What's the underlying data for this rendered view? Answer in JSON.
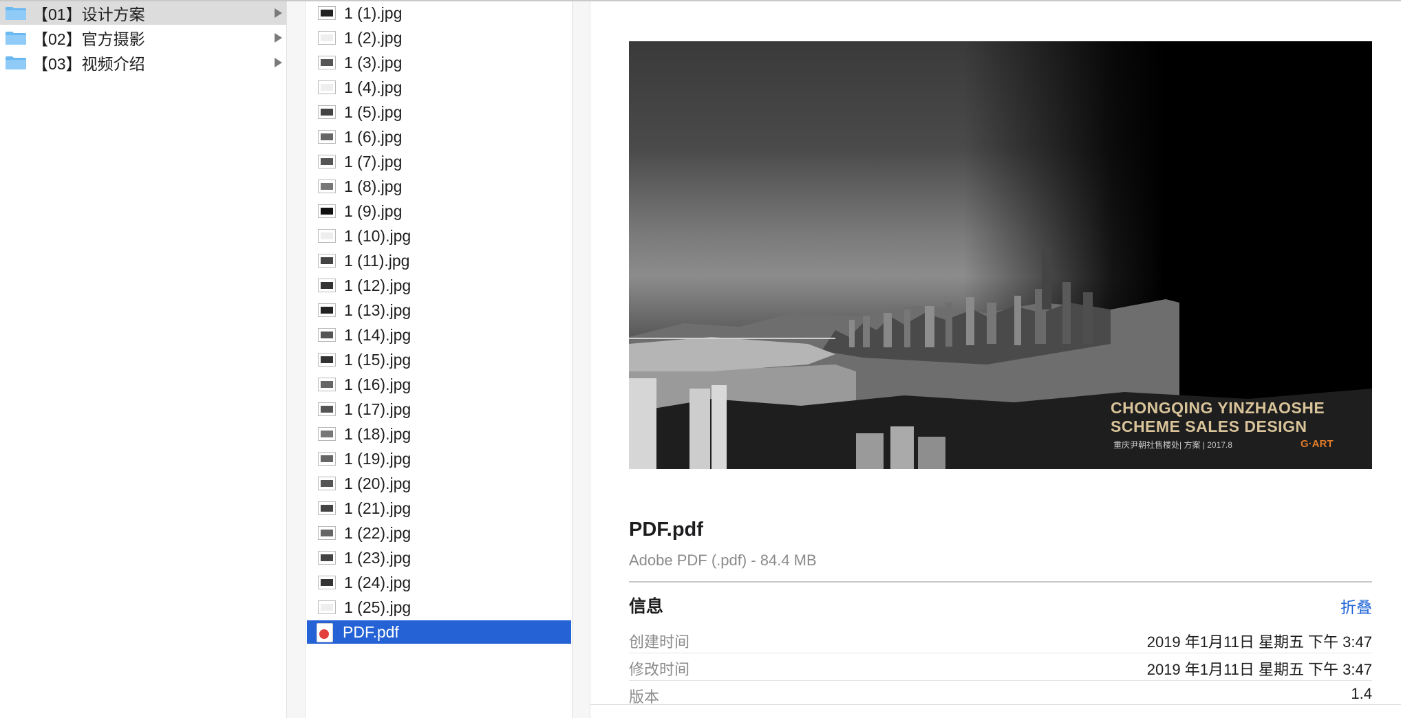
{
  "folders": [
    {
      "label": "【01】设计方案",
      "selected": true
    },
    {
      "label": "【02】官方摄影",
      "selected": false
    },
    {
      "label": "【03】视频介绍",
      "selected": false
    }
  ],
  "files": [
    {
      "label": "1 (1).jpg"
    },
    {
      "label": "1 (2).jpg"
    },
    {
      "label": "1 (3).jpg"
    },
    {
      "label": "1 (4).jpg"
    },
    {
      "label": "1 (5).jpg"
    },
    {
      "label": "1 (6).jpg"
    },
    {
      "label": "1 (7).jpg"
    },
    {
      "label": "1 (8).jpg"
    },
    {
      "label": "1 (9).jpg"
    },
    {
      "label": "1 (10).jpg"
    },
    {
      "label": "1 (11).jpg"
    },
    {
      "label": "1 (12).jpg"
    },
    {
      "label": "1 (13).jpg"
    },
    {
      "label": "1 (14).jpg"
    },
    {
      "label": "1 (15).jpg"
    },
    {
      "label": "1 (16).jpg"
    },
    {
      "label": "1 (17).jpg"
    },
    {
      "label": "1 (18).jpg"
    },
    {
      "label": "1 (19).jpg"
    },
    {
      "label": "1 (20).jpg"
    },
    {
      "label": "1 (21).jpg"
    },
    {
      "label": "1 (22).jpg"
    },
    {
      "label": "1 (23).jpg"
    },
    {
      "label": "1 (24).jpg"
    },
    {
      "label": "1 (25).jpg"
    }
  ],
  "selected_file": {
    "label": "PDF.pdf"
  },
  "preview": {
    "image_title_line1": "CHONGQING YINZHAOSHE",
    "image_title_line2": "SCHEME SALES DESIGN",
    "image_subtitle": "重庆尹朝社售楼处| 方案 | 2017.8",
    "image_brand": "G·ART",
    "file_name": "PDF.pdf",
    "file_kind": "Adobe PDF (.pdf) - 84.4 MB",
    "info_title": "信息",
    "collapse_label": "折叠",
    "info_rows": [
      {
        "key": "创建时间",
        "value": "2019 年1月11日 星期五 下午 3:47"
      },
      {
        "key": "修改时间",
        "value": "2019 年1月11日 星期五 下午 3:47"
      },
      {
        "key": "版本",
        "value": "1.4"
      }
    ]
  },
  "colors": {
    "selection_blue": "#2462d5",
    "link_blue": "#2468d6",
    "folder_blue": "#6cb8f0"
  }
}
